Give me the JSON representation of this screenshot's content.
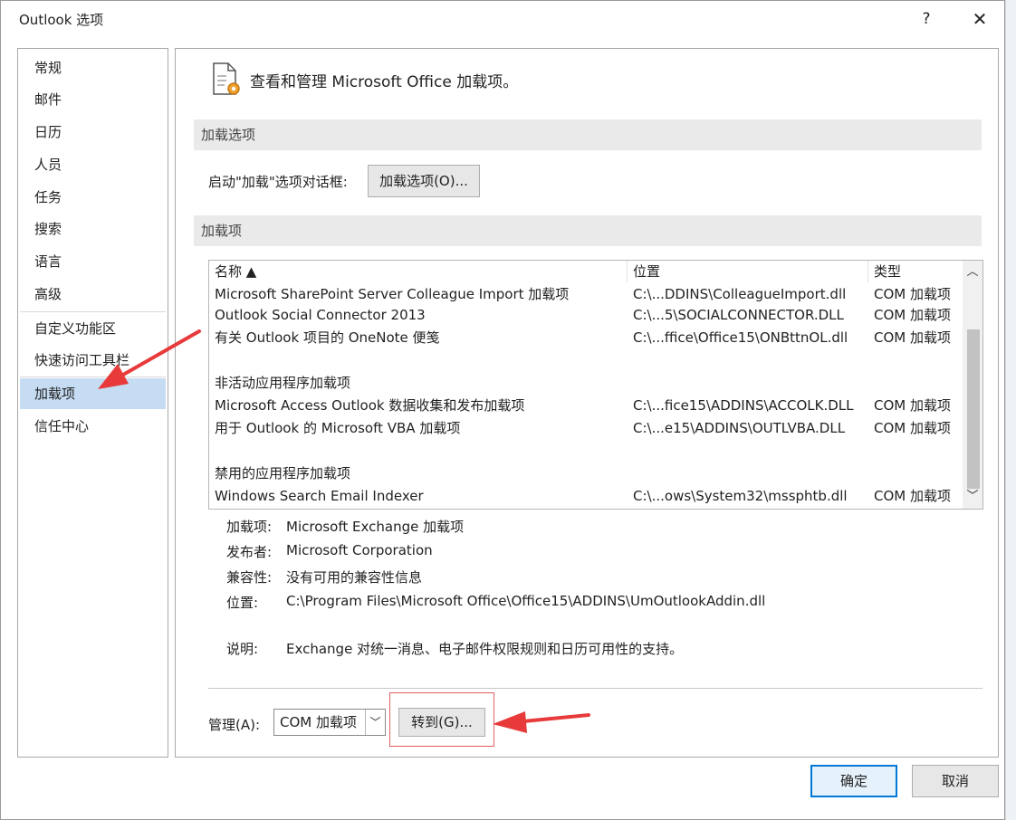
{
  "window": {
    "title": "Outlook 选项",
    "help": "?",
    "close": "✕"
  },
  "sidebar": {
    "items": [
      {
        "label": "常规"
      },
      {
        "label": "邮件"
      },
      {
        "label": "日历"
      },
      {
        "label": "人员"
      },
      {
        "label": "任务"
      },
      {
        "label": "搜索"
      },
      {
        "label": "语言"
      },
      {
        "label": "高级"
      },
      {
        "label": "自定义功能区"
      },
      {
        "label": "快速访问工具栏"
      },
      {
        "label": "加载项"
      },
      {
        "label": "信任中心"
      }
    ],
    "selected": "加载项"
  },
  "header": {
    "text": "查看和管理 Microsoft Office 加载项。"
  },
  "options_section": {
    "title": "加载选项",
    "label": "启动\"加载\"选项对话框:",
    "button": "加载选项(O)..."
  },
  "addins_section": {
    "title": "加载项",
    "columns": [
      "名称 ▲",
      "位置",
      "类型"
    ],
    "rows": [
      {
        "name": "Microsoft SharePoint Server Colleague Import 加载项",
        "location": "C:\\...DDINS\\ColleagueImport.dll",
        "type": "COM 加载项"
      },
      {
        "name": "Outlook Social Connector 2013",
        "location": "C:\\...5\\SOCIALCONNECTOR.DLL",
        "type": "COM 加载项"
      },
      {
        "name": "有关 Outlook 项目的 OneNote 便笺",
        "location": "C:\\...ffice\\Office15\\ONBttnOL.dll",
        "type": "COM 加载项"
      }
    ],
    "inactive_group": "非活动应用程序加载项",
    "inactive_rows": [
      {
        "name": "Microsoft Access Outlook 数据收集和发布加载项",
        "location": "C:\\...fice15\\ADDINS\\ACCOLK.DLL",
        "type": "COM 加载项"
      },
      {
        "name": "用于 Outlook 的 Microsoft VBA 加载项",
        "location": "C:\\...e15\\ADDINS\\OUTLVBA.DLL",
        "type": "COM 加载项"
      }
    ],
    "disabled_group": "禁用的应用程序加载项",
    "disabled_rows": [
      {
        "name": "Windows Search Email Indexer",
        "location": "C:\\...ows\\System32\\mssphtb.dll",
        "type": "COM 加载项"
      }
    ]
  },
  "details": {
    "addin_label": "加载项:",
    "addin_value": "Microsoft Exchange 加载项",
    "publisher_label": "发布者:",
    "publisher_value": "Microsoft Corporation",
    "compat_label": "兼容性:",
    "compat_value": "没有可用的兼容性信息",
    "location_label": "位置:",
    "location_value": "C:\\Program Files\\Microsoft Office\\Office15\\ADDINS\\UmOutlookAddin.dll",
    "desc_label": "说明:",
    "desc_value": "Exchange 对统一消息、电子邮件权限规则和日历可用性的支持。"
  },
  "manage": {
    "label": "管理(A):",
    "selected": "COM 加载项",
    "go_button": "转到(G)..."
  },
  "footer": {
    "ok": "确定",
    "cancel": "取消"
  },
  "colors": {
    "selection": "#c6dcf3",
    "accent": "#0078d7",
    "annotation": "#e83a3a"
  }
}
